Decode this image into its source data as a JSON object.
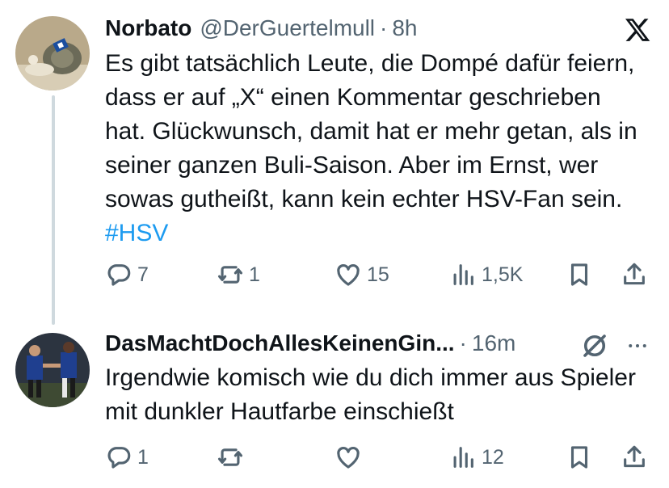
{
  "tweet1": {
    "display_name": "Norbato",
    "handle": "@DerGuertelmull",
    "separator": "·",
    "time": "8h",
    "text_main": "Es gibt tatsächlich Leute, die Dompé dafür feiern, dass er auf „X“ einen Kommentar geschrieben hat. Glückwunsch, damit hat er mehr getan, als in seiner ganzen Buli-Saison. Aber im Ernst, wer sowas gutheißt, kann kein echter HSV-Fan sein.",
    "hashtag": "#HSV",
    "replies": "7",
    "reposts": "1",
    "likes": "15",
    "views": "1,5K"
  },
  "tweet2": {
    "display_name": "DasMachtDochAllesKeinenGin...",
    "separator": "·",
    "time": "16m",
    "text": "Irgendwie komisch wie du dich immer aus Spieler mit dunkler Hautfarbe einschießt",
    "replies": "1",
    "reposts": "",
    "likes": "",
    "views": "12"
  },
  "colors": {
    "text": "#0f1419",
    "secondary": "#536471",
    "link": "#1d9bf0",
    "thread_line": "#cfd9de"
  },
  "icons": [
    "x-logo-icon",
    "reply-icon",
    "repost-icon",
    "like-icon",
    "views-icon",
    "bookmark-icon",
    "share-icon",
    "no-publish-icon",
    "more-icon"
  ]
}
